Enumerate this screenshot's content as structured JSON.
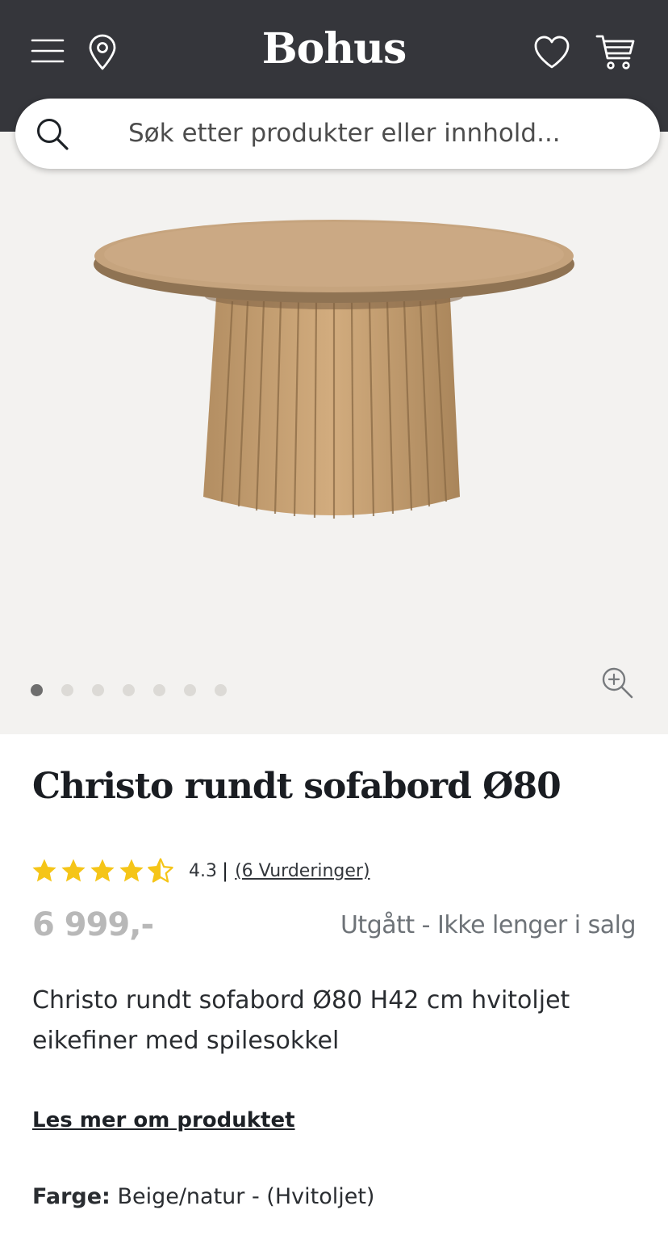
{
  "header": {
    "logo": "Bohus",
    "icons": [
      "menu-icon",
      "location-pin-icon",
      "heart-icon",
      "cart-icon"
    ],
    "background": "#35363b"
  },
  "search": {
    "placeholder": "Søk etter produkter eller innhold...",
    "icon": "search-icon"
  },
  "gallery": {
    "image": "round slatted coffee table",
    "slide_count": 7,
    "active_slide": 1,
    "zoom_icon": "zoom-in-icon"
  },
  "product": {
    "title": "Christo rundt sofabord Ø80",
    "rating": {
      "value": "4.3",
      "stars_value": 4.5,
      "separator": "|",
      "count_label": "(6 Vurderinger)",
      "star_color": "#f5c518"
    },
    "price": "6 999,-",
    "status": "Utgått - Ikke lenger i salg",
    "description": "Christo rundt sofabord Ø80 H42 cm hvitoljet eikefiner med spilesokkel",
    "read_more": "Les mer om produktet",
    "color_label": "Farge:",
    "color_value": "Beige/natur - (Hvitoljet)"
  }
}
